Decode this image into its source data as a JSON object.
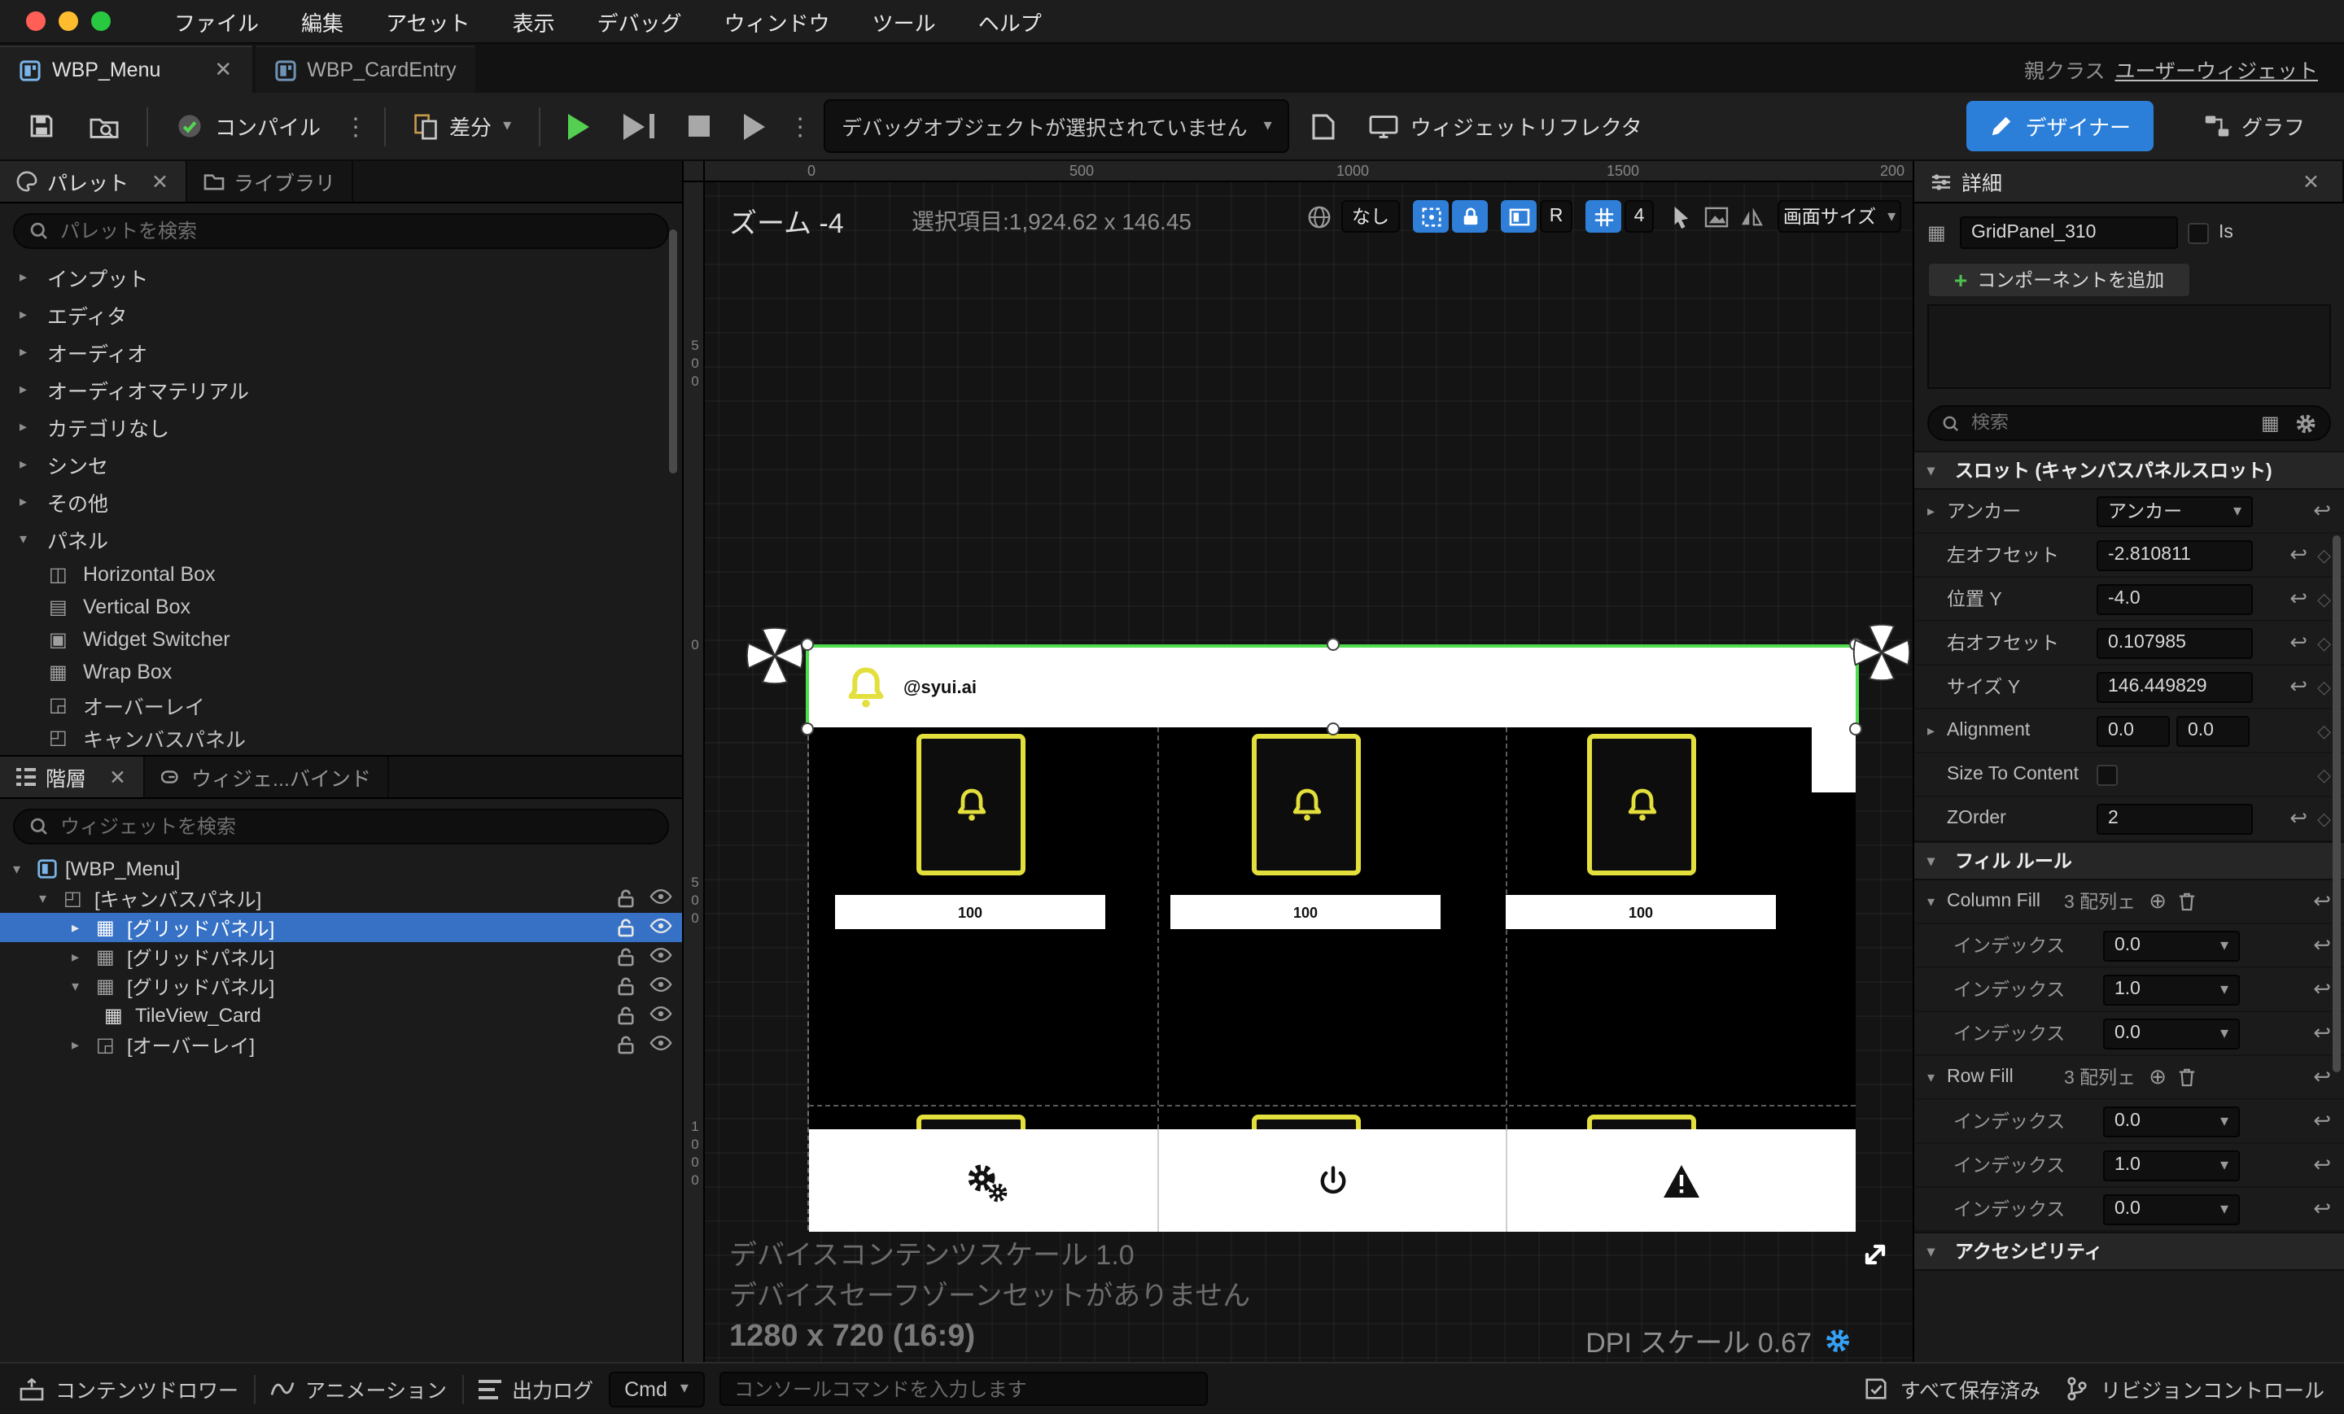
{
  "colors": {
    "accent_blue": "#2f7fd9",
    "selection_blue": "#3671c5",
    "designer_blue": "#2b7fd9",
    "card_yellow": "#e3df3c",
    "play_green": "#55cf52",
    "selection_outline_green": "#4fdc4d",
    "traffic_red": "#ff5f57",
    "traffic_yellow": "#febc2e",
    "traffic_green": "#28c840"
  },
  "menubar": {
    "items": [
      "ファイル",
      "編集",
      "アセット",
      "表示",
      "デバッグ",
      "ウィンドウ",
      "ツール",
      "ヘルプ"
    ]
  },
  "tabs": {
    "active": "WBP_Menu",
    "inactive": "WBP_CardEntry",
    "parent_label": "親クラス",
    "parent_value": "ユーザーウィジェット"
  },
  "toolbar": {
    "compile": "コンパイル",
    "diff": "差分",
    "debug_dropdown": "デバッグオブジェクトが選択されていません",
    "reflector": "ウィジェットリフレクタ",
    "designer": "デザイナー",
    "graph": "グラフ"
  },
  "palette": {
    "tab": "パレット",
    "library_tab": "ライブラリ",
    "search_placeholder": "パレットを検索",
    "groups": [
      "インプット",
      "エディタ",
      "オーディオ",
      "オーディオマテリアル",
      "カテゴリなし",
      "シンセ",
      "その他",
      "パネル"
    ],
    "panel_items": [
      "Horizontal Box",
      "Vertical Box",
      "Widget Switcher",
      "Wrap Box",
      "オーバーレイ",
      "キャンバスパネル"
    ]
  },
  "hierarchy": {
    "tab": "階層",
    "bind_tab": "ウィジェ...バインド",
    "search_placeholder": "ウィジェットを検索",
    "items": [
      "[WBP_Menu]",
      "[キャンバスパネル]",
      "[グリッドパネル]",
      "[グリッドパネル]",
      "[グリッドパネル]",
      "TileView_Card",
      "[オーバーレイ]"
    ]
  },
  "viewport": {
    "zoom_label": "ズーム -4",
    "selection_info": "選択項目:1,924.62 x 146.45",
    "none_button": "なし",
    "r_button": "R",
    "grid_count": "4",
    "screen_size": "画面サイズ",
    "ruler_top": [
      "0",
      "500",
      "1000",
      "1500",
      "200"
    ],
    "ruler_left": [
      "500",
      "0",
      "500",
      "1000"
    ],
    "design": {
      "account": "@syui.ai",
      "card_value": "100"
    },
    "device_scale": "デバイスコンテンツスケール 1.0",
    "safe_zone": "デバイスセーフゾーンセットがありません",
    "resolution": "1280 x 720 (16:9)",
    "dpi_scale": "DPI スケール 0.67"
  },
  "details": {
    "title": "詳細",
    "widget_name": "GridPanel_310",
    "is_label": "Is",
    "add_component": "コンポーネントを追加",
    "search_placeholder": "検索",
    "slot_section": "スロット (キャンバスパネルスロット)",
    "anchor_label": "アンカー",
    "anchor_value": "アンカー",
    "left_offset_label": "左オフセット",
    "left_offset_value": "-2.810811",
    "pos_y_label": "位置 Y",
    "pos_y_value": "-4.0",
    "right_offset_label": "右オフセット",
    "right_offset_value": "0.107985",
    "size_y_label": "サイズ Y",
    "size_y_value": "146.449829",
    "alignment_label": "Alignment",
    "alignment_x": "0.0",
    "alignment_y": "0.0",
    "size_to_content_label": "Size To Content",
    "zorder_label": "ZOrder",
    "zorder_value": "2",
    "fill_section": "フィル ルール",
    "column_fill_label": "Column Fill",
    "row_fill_label": "Row Fill",
    "array_count": "3 配列ェ",
    "index_label": "インデックス",
    "column_indices": [
      "0.0",
      "1.0",
      "0.0"
    ],
    "row_indices": [
      "0.0",
      "1.0",
      "0.0"
    ],
    "accessibility_section": "アクセシビリティ"
  },
  "statusbar": {
    "content_drawer": "コンテンツドロワー",
    "animation": "アニメーション",
    "output_log": "出力ログ",
    "cmd": "Cmd",
    "console_placeholder": "コンソールコマンドを入力します",
    "all_saved": "すべて保存済み",
    "revision_control": "リビジョンコントロール"
  }
}
